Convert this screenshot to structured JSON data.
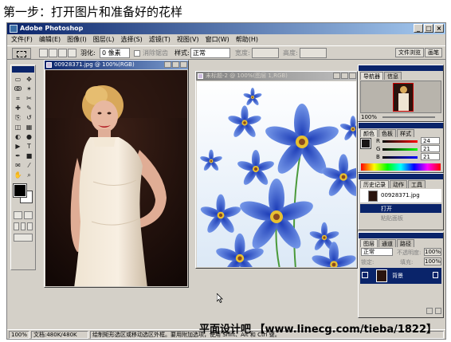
{
  "step_title": "第一步：打开图片和准备好的花样",
  "app": {
    "title": "Adobe Photoshop",
    "window_buttons": [
      "_",
      "□",
      "×"
    ]
  },
  "menu": [
    "文件(F)",
    "编辑(E)",
    "图像(I)",
    "图层(L)",
    "选择(S)",
    "滤镜(T)",
    "视图(V)",
    "窗口(W)",
    "帮助(H)"
  ],
  "options": {
    "feather_label": "羽化:",
    "feather_value": "0 像素",
    "antialias_label": "消除锯齿",
    "style_label": "样式:",
    "style_value": "正常",
    "width_label": "宽度:",
    "height_label": "高度:",
    "palette_tabs": [
      "文件浏览",
      "画笔"
    ]
  },
  "doc1": {
    "title": "00928371.jpg @ 100%(RGB)"
  },
  "doc2": {
    "title": "未标题-2 @ 100%(图层 1,RGB)"
  },
  "navigator": {
    "tabs": [
      "导航器",
      "信息"
    ],
    "zoom": "100%"
  },
  "color_panel": {
    "tabs": [
      "颜色",
      "色板",
      "样式"
    ],
    "r_label": "R",
    "r_value": "24",
    "g_label": "G",
    "g_value": "21",
    "b_label": "B",
    "b_value": "21"
  },
  "history": {
    "tabs": [
      "历史记录",
      "动作",
      "工具"
    ],
    "snapshot": "00928371.jpg",
    "items": [
      "打开",
      "粘贴面板"
    ]
  },
  "layers": {
    "tabs": [
      "图层",
      "通道",
      "路径"
    ],
    "mode": "正常",
    "opacity_label": "不透明度:",
    "opacity_value": "100%",
    "lock_label": "锁定:",
    "fill_label": "填充:",
    "fill_value": "100%",
    "layer_name": "背景"
  },
  "status": {
    "zoom": "100%",
    "doc_info": "文档:480K/480K",
    "hint": "绘制矩形选区或移动选区外框。要用附加选项，使用 Shift、Alt 和 Ctrl 键。"
  },
  "watermark": "平面设计吧 【www.linecg.com/tieba/1822】",
  "colors": {
    "title_blue": "#0a246a",
    "chrome": "#d4d0c8",
    "swatch_fg": "#181515"
  },
  "tool_icons": [
    "marquee-icon",
    "move-icon",
    "lasso-icon",
    "magic-wand-icon",
    "crop-icon",
    "slice-icon",
    "heal-icon",
    "brush-icon",
    "clone-icon",
    "history-brush-icon",
    "eraser-icon",
    "gradient-icon",
    "blur-icon",
    "dodge-icon",
    "path-select-icon",
    "type-icon",
    "pen-icon",
    "shape-icon",
    "notes-icon",
    "eyedropper-icon",
    "hand-icon",
    "zoom-icon"
  ]
}
